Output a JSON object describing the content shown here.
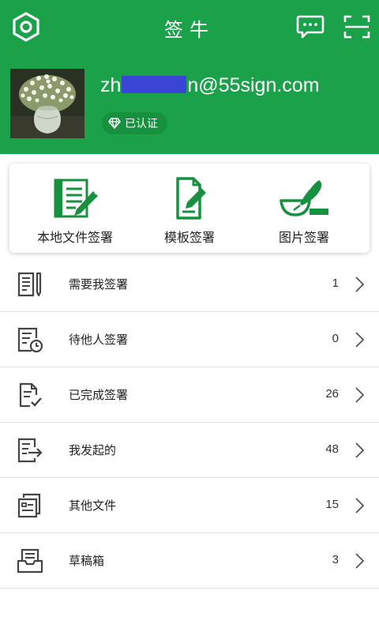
{
  "header": {
    "title": "签牛",
    "icons": {
      "settings": "settings-hexagon-icon",
      "chat": "message-dots-icon",
      "scan": "scan-frame-icon"
    },
    "colors": {
      "brand_green": "#1ba14a",
      "badge_green": "#17913f"
    }
  },
  "profile": {
    "email_prefix": "zh",
    "email_suffix": "n@55sign.com",
    "verified_label": "已认证"
  },
  "actions": [
    {
      "label": "本地文件签署",
      "icon": "notebook-pen-icon"
    },
    {
      "label": "模板签署",
      "icon": "document-edit-icon"
    },
    {
      "label": "图片签署",
      "icon": "feather-pen-icon"
    }
  ],
  "list": [
    {
      "label": "需要我签署",
      "count": "1",
      "icon": "doc-pen-icon"
    },
    {
      "label": "待他人签署",
      "count": "0",
      "icon": "doc-clock-icon"
    },
    {
      "label": "已完成签署",
      "count": "26",
      "icon": "doc-check-icon"
    },
    {
      "label": "我发起的",
      "count": "48",
      "icon": "doc-send-icon"
    },
    {
      "label": "其他文件",
      "count": "15",
      "icon": "doc-stack-icon"
    },
    {
      "label": "草稿箱",
      "count": "3",
      "icon": "inbox-tray-icon"
    }
  ]
}
